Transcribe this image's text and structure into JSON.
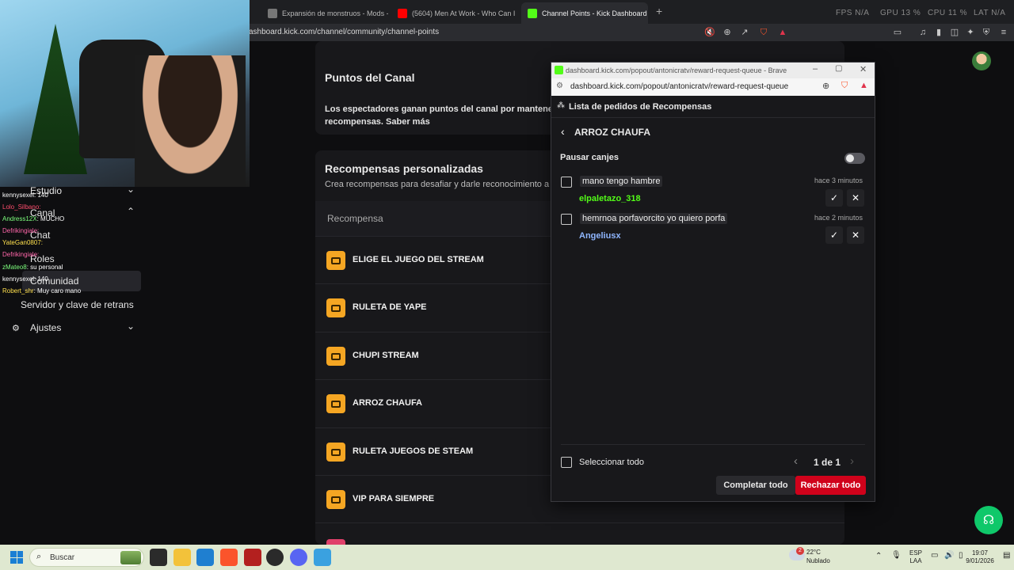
{
  "browser": {
    "tabs": [
      {
        "label": "Expansión de monstruos - Mods - M"
      },
      {
        "label": "(5604) Men At Work - Who Can I"
      },
      {
        "label": "Channel Points - Kick Dashboard"
      }
    ],
    "new_tab": "+",
    "url": "ashboard.kick.com/channel/community/channel-points",
    "overlay_stats": {
      "fps_label": "FPS",
      "fps": "N/A",
      "gpu_label": "GPU",
      "gpu": "13 %",
      "cpu_label": "CPU",
      "cpu": "11 %",
      "lat_label": "LAT",
      "lat": "N/A"
    }
  },
  "sidebar": {
    "items": [
      {
        "label": "Estudio"
      },
      {
        "label": "Canal"
      },
      {
        "label": "Chat"
      },
      {
        "label": "Roles"
      },
      {
        "label": "Comunidad"
      },
      {
        "label": "Servidor y clave de retrans"
      },
      {
        "label": "Ajustes"
      }
    ]
  },
  "chat_overlay": [
    {
      "user": "kennysexel",
      "text": ": 140",
      "color": "#ffffff"
    },
    {
      "user": "Lolo_Silbano",
      "text": ":",
      "color": "#ff4d6d"
    },
    {
      "user": "Andress12X",
      "text": ": MUCHO",
      "color": "#7dff7d"
    },
    {
      "user": "Defrikingiale",
      "text": ":",
      "color": "#ff66aa"
    },
    {
      "user": "YateGan0807",
      "text": ":",
      "color": "#ffe04d"
    },
    {
      "user": "Defrikingiale",
      "text": ":",
      "color": "#ff66aa"
    },
    {
      "user": "kennysexel",
      "text": ": 140",
      "color": "#ffffff"
    },
    {
      "user": "zMateo8",
      "text": ": su personal",
      "color": "#7dff7d"
    },
    {
      "user": "Robert_shr",
      "text": ": Muy caro mano",
      "color": "#ffe04d"
    }
  ],
  "main": {
    "points_title": "Puntos del Canal",
    "points_desc_1": "Los espectadores ganan puntos del canal por mantenerse",
    "points_desc_2": "recompensas. Saber más",
    "custom_title": "Recompensas personalizadas",
    "custom_desc": "Crea recompensas para desafiar y darle reconocimiento a t",
    "column_header": "Recompensa",
    "rewards": [
      {
        "name": "ELIGE EL JUEGO DEL STREAM"
      },
      {
        "name": "RULETA DE YAPE"
      },
      {
        "name": "CHUPI STREAM"
      },
      {
        "name": "ARROZ CHAUFA"
      },
      {
        "name": "RULETA JUEGOS DE STEAM"
      },
      {
        "name": "VIP PARA SIEMPRE"
      }
    ]
  },
  "popup": {
    "window_title": "dashboard.kick.com/popout/antonicratv/reward-request-queue - Brave",
    "url": "dashboard.kick.com/popout/antonicratv/reward-request-queue",
    "header": "Lista de pedidos de Recompensas",
    "reward_title": "ARROZ CHAUFA",
    "pause_label": "Pausar canjes",
    "pause_on": false,
    "requests": [
      {
        "message": "mano tengo hambre",
        "time": "hace 3 minutos",
        "user": "elpaletazo_318",
        "user_color": "#53fc18"
      },
      {
        "message": "hemrnoa porfavorcito yo quiero porfa",
        "time": "hace 2 minutos",
        "user": "Angeliusx",
        "user_color": "#8fb6ff"
      }
    ],
    "select_all": "Seleccionar todo",
    "pagination": "1 de 1",
    "complete_all": "Completar todo",
    "reject_all": "Rechazar todo",
    "accent_reject": "#d0021b"
  },
  "taskbar": {
    "search_placeholder": "Buscar",
    "weather_temp": "22°C",
    "weather_desc": "Nublado",
    "weather_badge": "2",
    "lang_1": "ESP",
    "lang_2": "LAA",
    "time": "19:07",
    "date": "9/01/2026"
  }
}
